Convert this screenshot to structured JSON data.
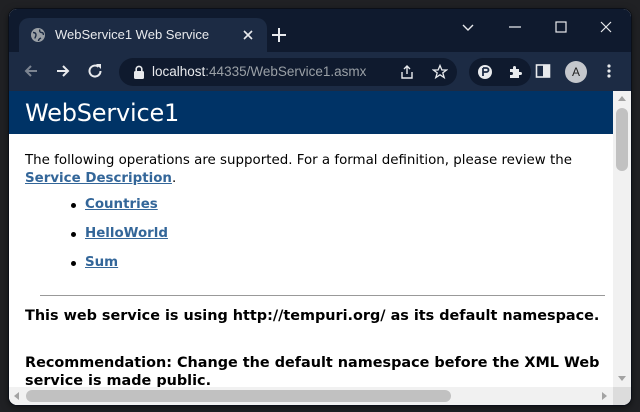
{
  "browser": {
    "tab": {
      "title": "WebService1 Web Service",
      "favicon": "globe-icon"
    },
    "omnibox": {
      "host": "localhost",
      "rest": ":44335/WebService1.asmx"
    },
    "profile_initial": "A",
    "icons": [
      "back-icon",
      "forward-icon",
      "reload-icon",
      "lock-icon",
      "share-icon",
      "star-icon",
      "extension-icon",
      "puzzle-icon",
      "sidepanel-icon",
      "menu-icon"
    ]
  },
  "page": {
    "title": "WebService1",
    "intro_text": "The following operations are supported. For a formal definition, please review the",
    "intro_link": "Service Description",
    "intro_end": ".",
    "operations": [
      "Countries",
      "HelloWorld",
      "Sum"
    ],
    "notice_namespace": "This web service is using http://tempuri.org/ as its default namespace.",
    "notice_recommendation": "Recommendation: Change the default namespace before the XML Web service is made public."
  },
  "colors": {
    "heading_band": "#003366",
    "link": "#336699",
    "browser_frame": "#0f1a2e",
    "toolbar": "#1c2b44"
  }
}
